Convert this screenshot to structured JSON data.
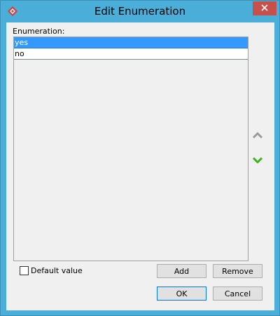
{
  "window": {
    "title": "Edit Enumeration",
    "close_icon": "close-x-icon",
    "app_icon": "visual-paradigm-icon"
  },
  "enumeration": {
    "label": "Enumeration:",
    "items": [
      {
        "label": "yes",
        "selected": true
      },
      {
        "label": "no",
        "selected": false
      }
    ]
  },
  "side_controls": {
    "move_up_icon": "chevron-up-icon",
    "move_down_icon": "chevron-down-icon",
    "move_up_color": "#9a9a9a",
    "move_down_color": "#3cb31b"
  },
  "default_value": {
    "label": "Default value",
    "checked": false
  },
  "buttons": {
    "add": "Add",
    "remove": "Remove",
    "ok": "OK",
    "cancel": "Cancel"
  },
  "colors": {
    "titlebar": "#4aaed9",
    "close": "#c7504b",
    "selection": "#3399ff"
  }
}
